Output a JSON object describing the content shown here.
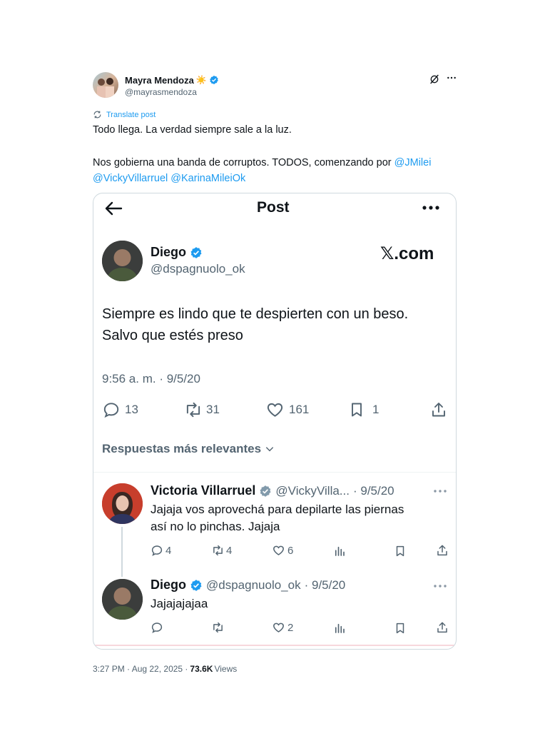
{
  "outer": {
    "author_name": "Mayra Mendoza",
    "author_emoji": "☀️",
    "author_handle": "@mayrasmendoza",
    "translate_label": "Translate post",
    "text_line1": "Todo llega. La verdad siempre sale a la luz.",
    "text_line2_prefix": "Nos gobierna una banda de corruptos. TODOS, comenzando por ",
    "mention1": "@JMilei",
    "mention2": "@VickyVillarruel",
    "mention3": "@KarinaMileiOk",
    "timestamp": "3:27 PM · Aug 22, 2025 · ",
    "views_count": "73.6K",
    "views_label": " Views"
  },
  "embed": {
    "header_title": "Post",
    "brand": "𝕏.com",
    "main_post": {
      "author_name": "Diego",
      "author_handle": "@dspagnuolo_ok",
      "text_line1": "Siempre es lindo que te despierten con un beso.",
      "text_line2": "Salvo que estés preso",
      "timestamp": "9:56 a. m. · 9/5/20",
      "replies": "13",
      "reposts": "31",
      "likes": "161",
      "bookmarks": "1"
    },
    "replies_sort_label": "Respuestas más relevantes",
    "reply1": {
      "author_name": "Victoria Villarruel",
      "author_handle": "@VickyVilla...",
      "date": "· 9/5/20",
      "text_line1": "Jajaja vos aprovechá para depilarte las piernas",
      "text_line2": "así no lo pinchas. Jajaja",
      "replies": "4",
      "reposts": "4",
      "likes": "6"
    },
    "reply2": {
      "author_name": "Diego",
      "author_handle": "@dspagnuolo_ok",
      "date": "· 9/5/20",
      "text": "Jajajajajaa",
      "likes": "2"
    }
  },
  "colors": {
    "accent": "#1d9bf0",
    "text": "#0f1419",
    "muted": "#536471",
    "border": "#cfd9de"
  }
}
